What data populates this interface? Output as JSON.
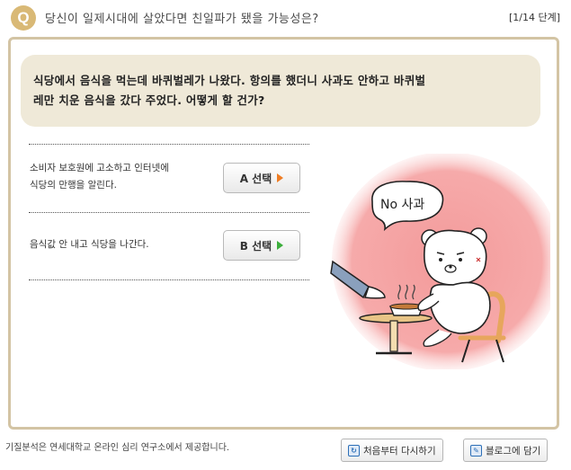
{
  "header": {
    "badge": "Q",
    "title": "당신이 일제시대에 살았다면 친일파가 됐을 가능성은?",
    "step": "[1/14 단계]"
  },
  "question": {
    "line1": "식당에서 음식을 먹는데 바퀴벌레가 나왔다. 항의를 했더니 사과도 안하고 바퀴벌",
    "line2": "레만 치운 음식을 갔다 주었다. 어떻게 할 건가?"
  },
  "options": [
    {
      "line1": "소비자 보호원에 고소하고 인터넷에",
      "line2": "식당의 만행을 알린다.",
      "button": "A 선택"
    },
    {
      "line1": "음식값 안 내고 식당을 나간다.",
      "button": "B 선택"
    }
  ],
  "illustration": {
    "speech": "No 사과"
  },
  "footer": {
    "note": "기질분석은 연세대학교 온라인 심리 연구소에서 제공합니다.",
    "restart": "처음부터 다시하기",
    "blog": "블로그에 담기"
  },
  "colors": {
    "frame": "#d3c4a4",
    "question_bg": "#efe9d8",
    "badge": "#d9b976",
    "illus_bg": "#f6a6a6",
    "arrow_a": "#ef7d24",
    "arrow_b": "#3cae3c"
  }
}
